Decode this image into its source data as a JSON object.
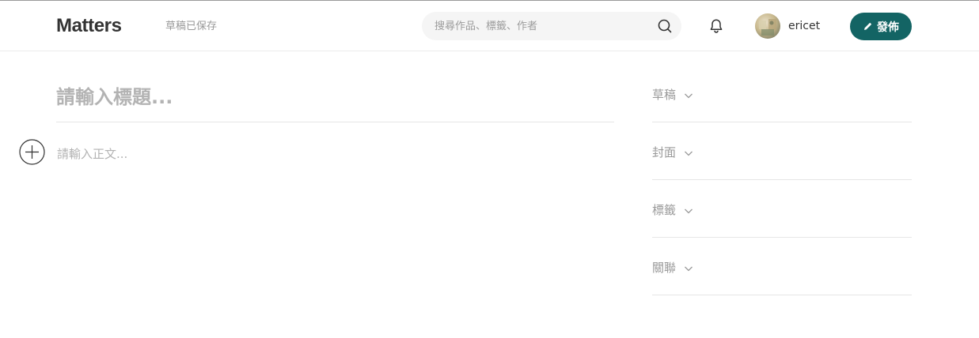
{
  "header": {
    "logo": "Matters",
    "draft_status": "草稿已保存",
    "search_placeholder": "搜尋作品、標籤、作者",
    "username": "ericet",
    "publish_label": "發佈"
  },
  "editor": {
    "title_placeholder": "請輸入標題...",
    "body_placeholder": "請輸入正文..."
  },
  "sidebar": {
    "sections": [
      {
        "label": "草稿"
      },
      {
        "label": "封面"
      },
      {
        "label": "標籤"
      },
      {
        "label": "關聯"
      }
    ]
  },
  "colors": {
    "accent": "#136464",
    "placeholder": "#b3b3b3",
    "divider": "#e6e6e6"
  }
}
